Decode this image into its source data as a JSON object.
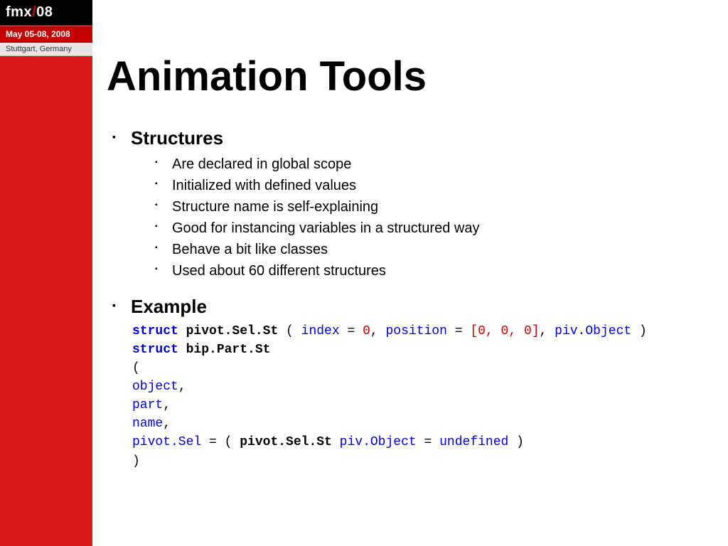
{
  "logo": {
    "top_pre": "fmx",
    "top_slash": "/",
    "top_post": "08",
    "mid": "May 05-08, 2008",
    "bot": "Stuttgart, Germany"
  },
  "title": "Animation Tools",
  "sections": {
    "structures": {
      "heading": "Structures",
      "bullets": [
        "Are declared in global scope",
        "Initialized with defined values",
        "Structure name is self-explaining",
        "Good for instancing variables in a structured way",
        "Behave a bit like classes",
        "Used about 60 different structures"
      ]
    },
    "example": {
      "heading": "Example",
      "code": {
        "l1": {
          "kw": "struct",
          "name": "pivot.Sel.St",
          "open": " ( ",
          "v1": "index",
          "eq1": " = ",
          "n1": "0",
          "c1": ", ",
          "v2": "position",
          "eq2": " = ",
          "n2": "[0, 0, 0]",
          "c2": ", ",
          "v3": "piv.Object",
          "close": " )"
        },
        "l2": {
          "kw": "struct",
          "name": "bip.Part.St"
        },
        "l3": "(",
        "l4": {
          "v": "object",
          "c": ","
        },
        "l5": {
          "v": "part",
          "c": ","
        },
        "l6": {
          "v": "name",
          "c": ","
        },
        "l7": {
          "v1": "pivot.Sel",
          "eq": " = ",
          "open": "( ",
          "name": "pivot.Sel.St",
          "sp": " ",
          "v2": "piv.Object",
          "eq2": " = ",
          "uv": "undefined",
          "close": " )"
        },
        "l8": ")"
      }
    }
  }
}
